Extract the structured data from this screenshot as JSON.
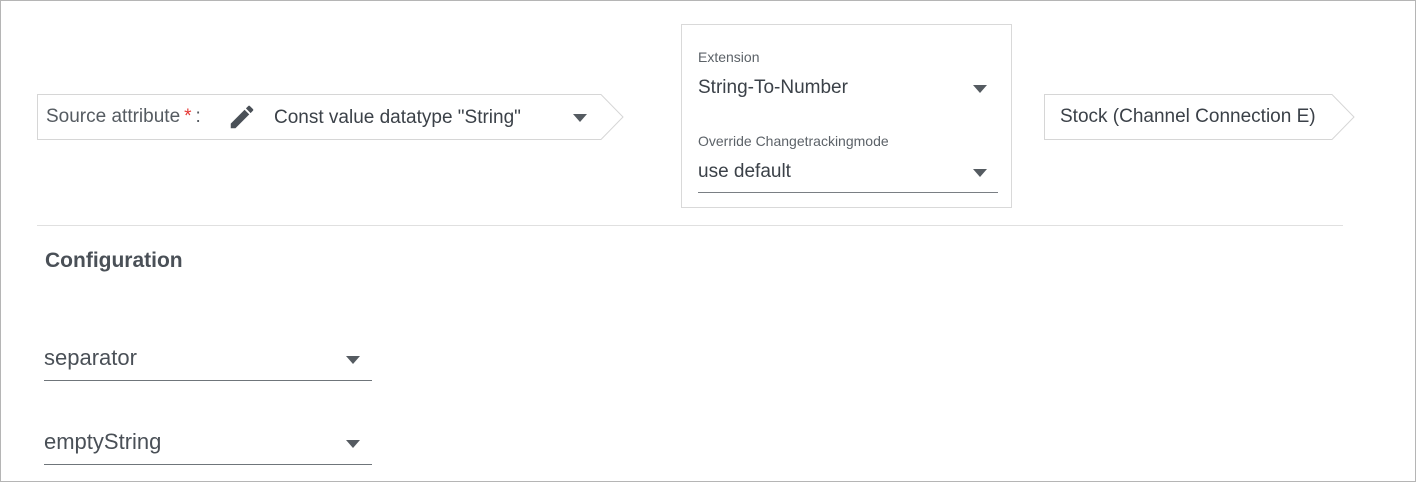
{
  "source": {
    "label": "Source attribute",
    "required_mark": "*",
    "colon": ":",
    "value": "Const value datatype \"String\""
  },
  "extension": {
    "label": "Extension",
    "value": "String-To-Number",
    "tracking_label": "Override Changetrackingmode",
    "tracking_value": "use default"
  },
  "target": {
    "label": "Stock (Channel Connection E)"
  },
  "configuration": {
    "title": "Configuration",
    "fields": [
      {
        "value": "separator"
      },
      {
        "value": "emptyString"
      }
    ]
  },
  "colors": {
    "required": "#e53935",
    "text": "#3b4148",
    "border": "#d9d9d9"
  }
}
